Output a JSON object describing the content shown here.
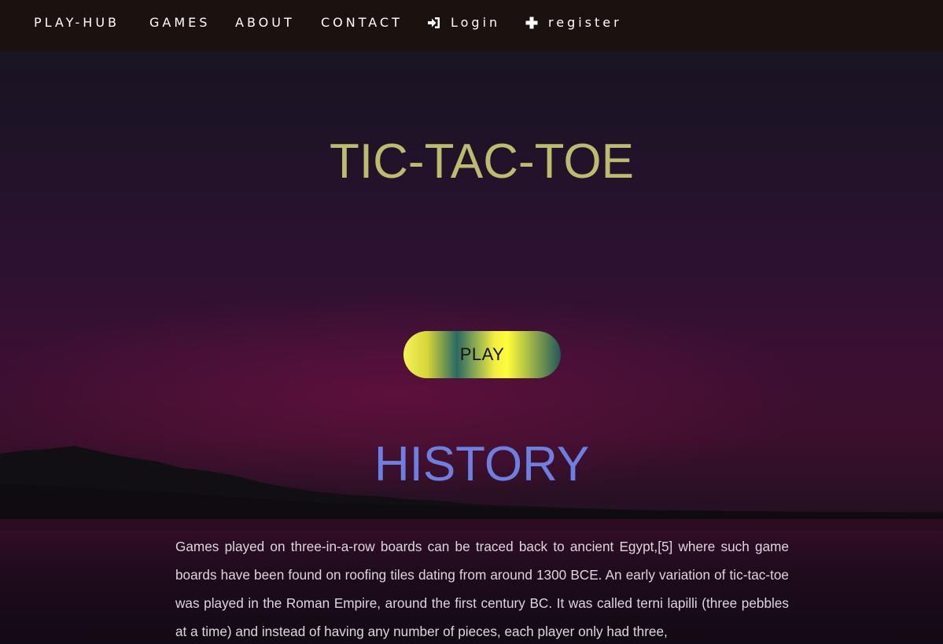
{
  "nav": {
    "brand": "PLAY-HUB",
    "games": "GAMES",
    "about": "ABOUT",
    "contact": "CONTACT",
    "login": "Login",
    "login_icon": "sign-in-icon",
    "register": "register",
    "register_icon": "plus-icon"
  },
  "hero": {
    "title": "TIC-TAC-TOE",
    "play_label": "PLAY"
  },
  "history": {
    "heading": "HISTORY",
    "text": "Games played on three-in-a-row boards can be traced back to ancient Egypt,[5] where such game boards have been found on roofing tiles dating from around 1300 BCE. An early variation of tic-tac-toe was played in the Roman Empire, around the first century BC. It was called terni lapilli (three pebbles at a time) and instead of having any number of pieces, each player only had three,"
  },
  "colors": {
    "navbar": "#1b1210",
    "title": "#bdbb6f",
    "history_heading": "#6d7fe0",
    "body_text": "#dcd6dc"
  }
}
